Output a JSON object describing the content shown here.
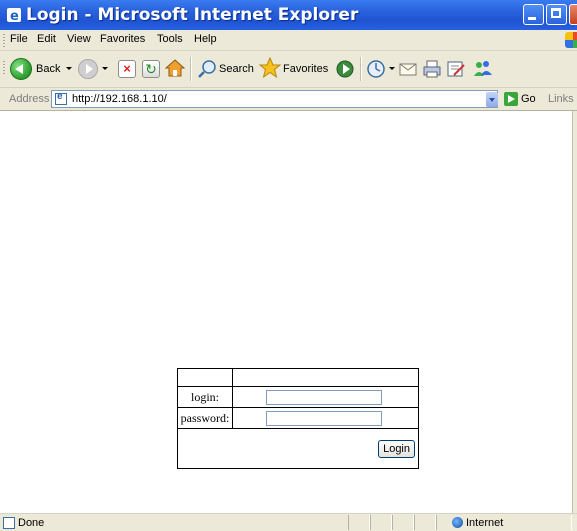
{
  "window": {
    "title": "Login - Microsoft Internet Explorer"
  },
  "menu": [
    "File",
    "Edit",
    "View",
    "Favorites",
    "Tools",
    "Help"
  ],
  "toolbar": {
    "back_label": "Back",
    "search_label": "Search",
    "favorites_label": "Favorites"
  },
  "address": {
    "label": "Address",
    "url": "http://192.168.1.10/",
    "go_label": "Go",
    "links_label": "Links"
  },
  "form": {
    "login_label": "login:",
    "password_label": "password:",
    "login_value": "",
    "password_value": "",
    "submit_label": "Login"
  },
  "status": {
    "text": "Done",
    "zone": "Internet"
  }
}
